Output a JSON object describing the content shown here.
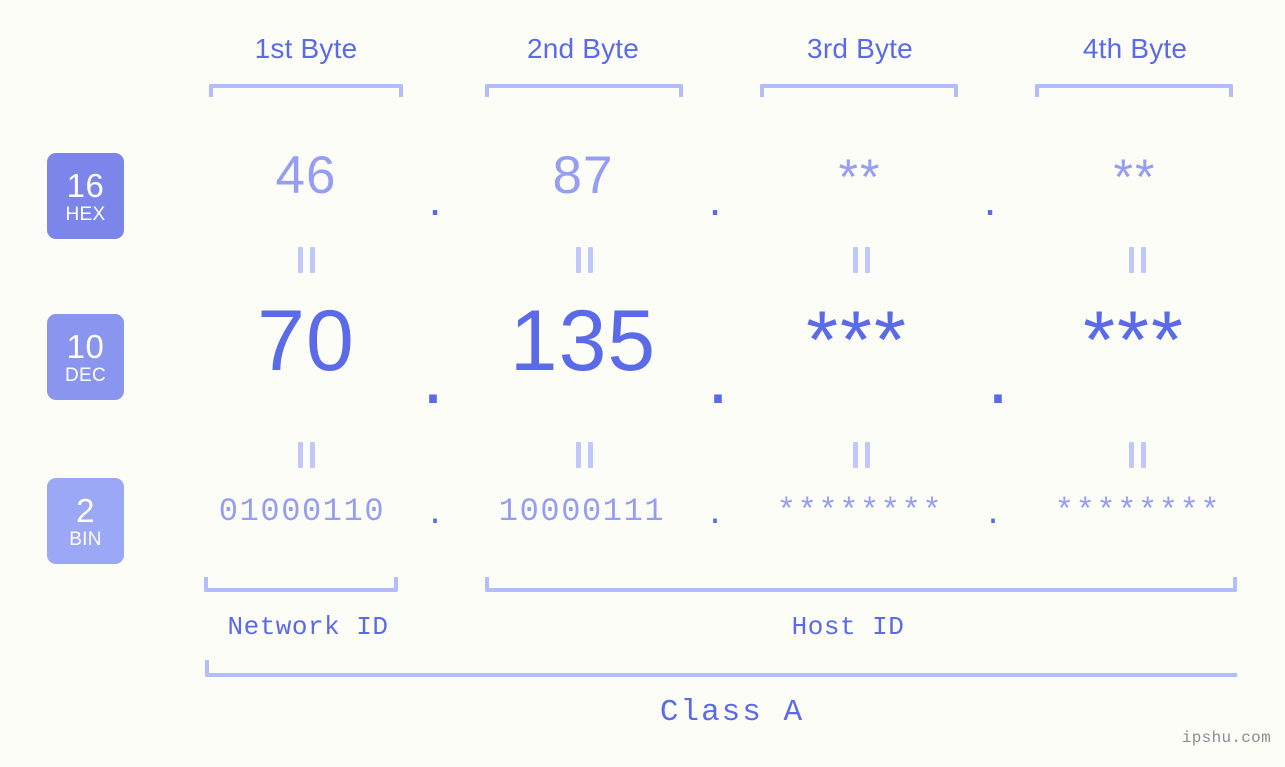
{
  "meta": {
    "background_color": "#fcfdf7",
    "accent_strong": "#5b6ae8",
    "accent_light": "#959ef2",
    "bracket_color": "#b4bdfb",
    "eq_color": "#c0c8fb",
    "watermark_color": "#8d8d93"
  },
  "headers": {
    "bytes": [
      {
        "label": "1st Byte"
      },
      {
        "label": "2nd Byte"
      },
      {
        "label": "3rd Byte"
      },
      {
        "label": "4th Byte"
      }
    ]
  },
  "bases": [
    {
      "number": "16",
      "name": "HEX",
      "color": "#7b85ea"
    },
    {
      "number": "10",
      "name": "DEC",
      "color": "#8a95ef"
    },
    {
      "number": "2",
      "name": "BIN",
      "color": "#9aa8f5"
    }
  ],
  "rows": {
    "hex": {
      "base_number": "16",
      "base_name": "HEX",
      "values": [
        "46",
        "87",
        "**",
        "**"
      ],
      "separators": [
        ".",
        ".",
        "."
      ]
    },
    "dec": {
      "base_number": "10",
      "base_name": "DEC",
      "values": [
        "70",
        "135",
        "***",
        "***"
      ],
      "separators": [
        ".",
        ".",
        "."
      ]
    },
    "bin": {
      "base_number": "2",
      "base_name": "BIN",
      "values": [
        "01000110",
        "10000111",
        "********",
        "********"
      ],
      "separators": [
        ".",
        ".",
        "."
      ]
    }
  },
  "equals_marks": {
    "glyph": "||",
    "count_per_row": 4,
    "rows": 2
  },
  "segments": {
    "network_id": {
      "label": "Network ID"
    },
    "host_id": {
      "label": "Host ID"
    }
  },
  "class": {
    "label": "Class A"
  },
  "watermark": {
    "text": "ipshu.com"
  }
}
